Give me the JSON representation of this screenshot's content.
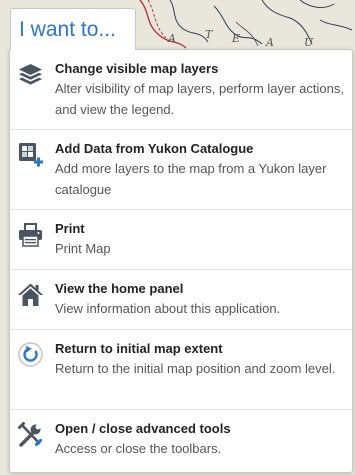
{
  "trigger_label": "I want to...",
  "menu_items": [
    {
      "icon": "layers-icon",
      "title": "Change visible map layers",
      "description": "Alter visibility of map layers, perform layer actions, and view the legend."
    },
    {
      "icon": "add-data-icon",
      "title": "Add Data from Yukon Catalogue",
      "description": "Add more layers to the map from a Yukon layer catalogue"
    },
    {
      "icon": "printer-icon",
      "title": "Print",
      "description": "Print Map"
    },
    {
      "icon": "home-icon",
      "title": "View the home panel",
      "description": "View information about this application."
    },
    {
      "icon": "refresh-icon",
      "title": "Return to initial map extent",
      "description": "Return to the initial map position and zoom level."
    },
    {
      "icon": "tools-icon",
      "title": "Open / close advanced tools",
      "description": "Access or close the toolbars."
    }
  ],
  "map_labels": [
    "A",
    "T",
    "E",
    "A",
    "U"
  ],
  "colors": {
    "accent": "#2a78c5",
    "icon_dark": "#4a5560",
    "icon_blue": "#2a78c5",
    "map_background": "#e9e6dc"
  }
}
